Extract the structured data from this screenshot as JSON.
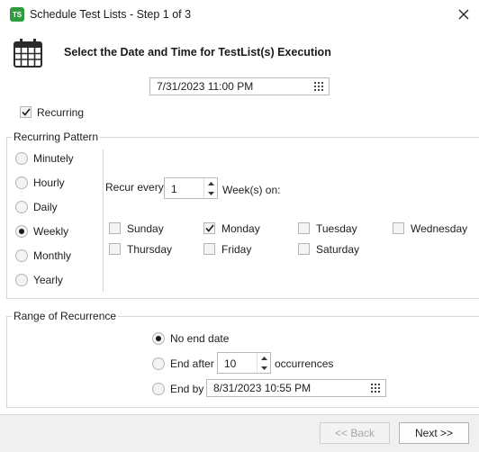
{
  "window": {
    "title": "Schedule Test Lists - Step 1 of 3",
    "app_icon_text": "TS",
    "app_icon_color": "#2e9c3d"
  },
  "header": {
    "heading": "Select the Date and Time for TestList(s) Execution",
    "icon": "calendar-icon"
  },
  "start": {
    "datetime": "7/31/2023 11:00 PM",
    "recurring_label": "Recurring",
    "recurring_checked": true
  },
  "pattern": {
    "title": "Recurring Pattern",
    "options": [
      "Minutely",
      "Hourly",
      "Daily",
      "Weekly",
      "Monthly",
      "Yearly"
    ],
    "selected": "Weekly",
    "recur_every_label": "Recur every",
    "recur_every_value": "1",
    "weeks_on_label": "Week(s) on:",
    "days": [
      {
        "label": "Sunday",
        "checked": false
      },
      {
        "label": "Monday",
        "checked": true
      },
      {
        "label": "Tuesday",
        "checked": false
      },
      {
        "label": "Wednesday",
        "checked": false
      },
      {
        "label": "Thursday",
        "checked": false
      },
      {
        "label": "Friday",
        "checked": false
      },
      {
        "label": "Saturday",
        "checked": false
      }
    ]
  },
  "range": {
    "title": "Range of Recurrence",
    "no_end_label": "No end date",
    "end_after_label": "End after",
    "end_after_value": "10",
    "occurrences_label": "occurrences",
    "end_by_label": "End by",
    "end_by_value": "8/31/2023 10:55 PM",
    "selected": "No end date"
  },
  "footer": {
    "back_label": "<< Back",
    "next_label": "Next >>"
  }
}
